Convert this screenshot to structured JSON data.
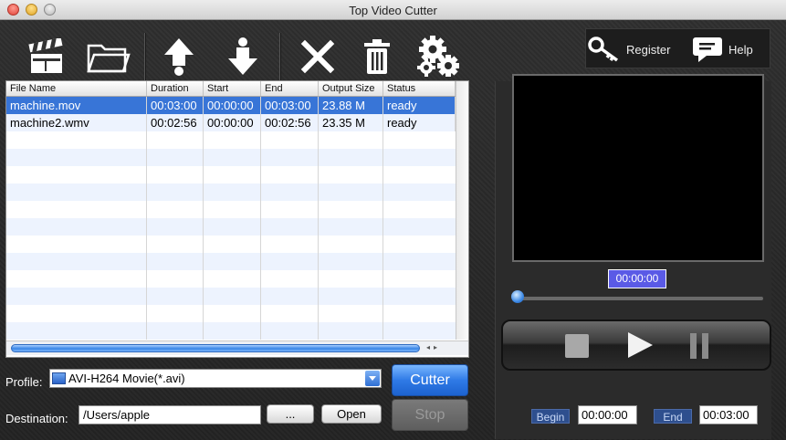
{
  "window": {
    "title": "Top Video Cutter"
  },
  "toolbar": {
    "items": [
      {
        "icon": "clapperboard-icon"
      },
      {
        "icon": "folder-icon"
      },
      {
        "icon": "move-up-arrow-icon"
      },
      {
        "icon": "move-down-arrow-icon"
      },
      {
        "icon": "delete-x-icon"
      },
      {
        "icon": "trash-icon"
      },
      {
        "icon": "gears-icon"
      }
    ],
    "register_label": "Register",
    "help_label": "Help"
  },
  "table": {
    "columns": [
      "File Name",
      "Duration",
      "Start",
      "End",
      "Output Size",
      "Status"
    ],
    "rows": [
      {
        "file": "machine.mov",
        "duration": "00:03:00",
        "start": "00:00:00",
        "end": "00:03:00",
        "size": "23.88 M",
        "status": "ready",
        "selected": true
      },
      {
        "file": "machine2.wmv",
        "duration": "00:02:56",
        "start": "00:00:00",
        "end": "00:02:56",
        "size": "23.35 M",
        "status": "ready",
        "selected": false
      }
    ]
  },
  "form": {
    "profile_label": "Profile:",
    "profile_value": "AVI-H264 Movie(*.avi)",
    "destination_label": "Destination:",
    "destination_value": "/Users/apple",
    "browse_label": "...",
    "open_label": "Open",
    "cutter_label": "Cutter",
    "stop_label": "Stop"
  },
  "preview": {
    "timecode": "00:00:00",
    "seek_fraction": 0,
    "begin_label": "Begin",
    "begin_value": "00:00:00",
    "end_label": "End",
    "end_value": "00:03:00"
  },
  "colors": {
    "selection": "#3875d7",
    "accent_blue": "#2f7ae6",
    "background": "#2a2a2a"
  }
}
